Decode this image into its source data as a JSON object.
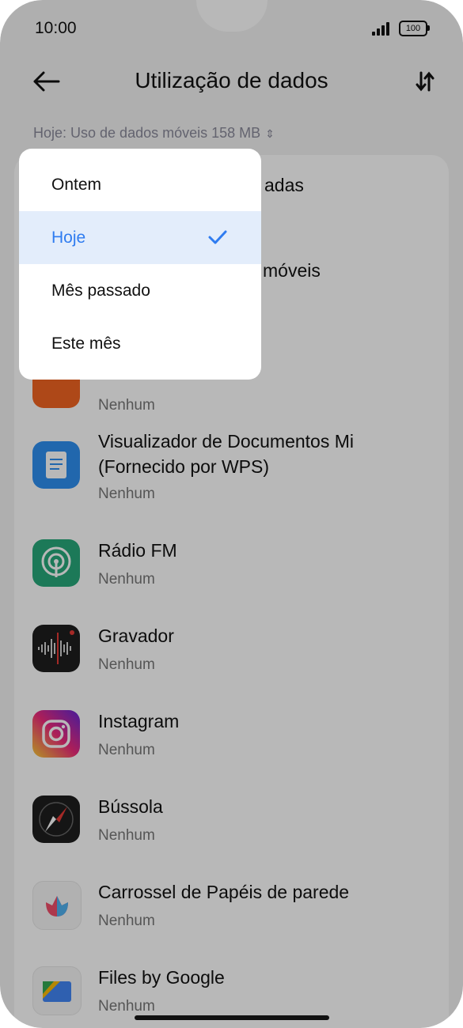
{
  "status": {
    "time": "10:00",
    "battery": "100"
  },
  "header": {
    "title": "Utilização de dados"
  },
  "filter": {
    "text": "Hoje: Uso de dados móveis 158 MB"
  },
  "list_partial": {
    "row1_name_tail": "adas",
    "row2_name_tail": "móveis",
    "row3_usage": "Nenhum"
  },
  "apps": [
    {
      "name": "Visualizador de Documentos Mi (Fornecido por WPS)",
      "usage": "Nenhum"
    },
    {
      "name": "Rádio FM",
      "usage": "Nenhum"
    },
    {
      "name": "Gravador",
      "usage": "Nenhum"
    },
    {
      "name": "Instagram",
      "usage": "Nenhum"
    },
    {
      "name": "Bússola",
      "usage": "Nenhum"
    },
    {
      "name": "Carrossel de Papéis de parede",
      "usage": "Nenhum"
    },
    {
      "name": "Files by Google",
      "usage": "Nenhum"
    }
  ],
  "menu": {
    "items": [
      {
        "label": "Ontem"
      },
      {
        "label": "Hoje"
      },
      {
        "label": "Mês passado"
      },
      {
        "label": "Este mês"
      }
    ],
    "selected_index": 1
  },
  "colors": {
    "accent": "#2f7cf0",
    "selected_bg": "#e3edfb",
    "background": "#f3f3f3"
  }
}
